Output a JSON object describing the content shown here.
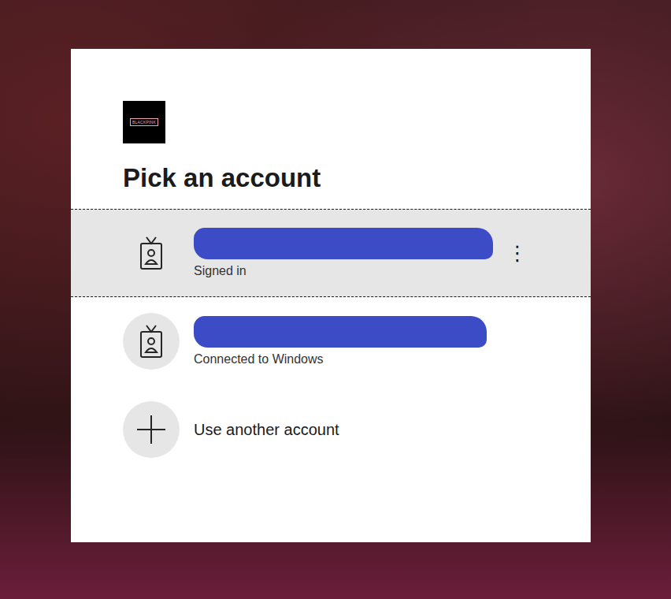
{
  "logo": {
    "text": "BLACKPINK"
  },
  "title": "Pick an account",
  "accounts": [
    {
      "redacted": true,
      "status": "Signed in",
      "selected": true,
      "more": "⋮"
    },
    {
      "redacted": true,
      "status": "Connected to Windows",
      "selected": false,
      "more": ""
    }
  ],
  "add_account": {
    "label": "Use another account"
  }
}
